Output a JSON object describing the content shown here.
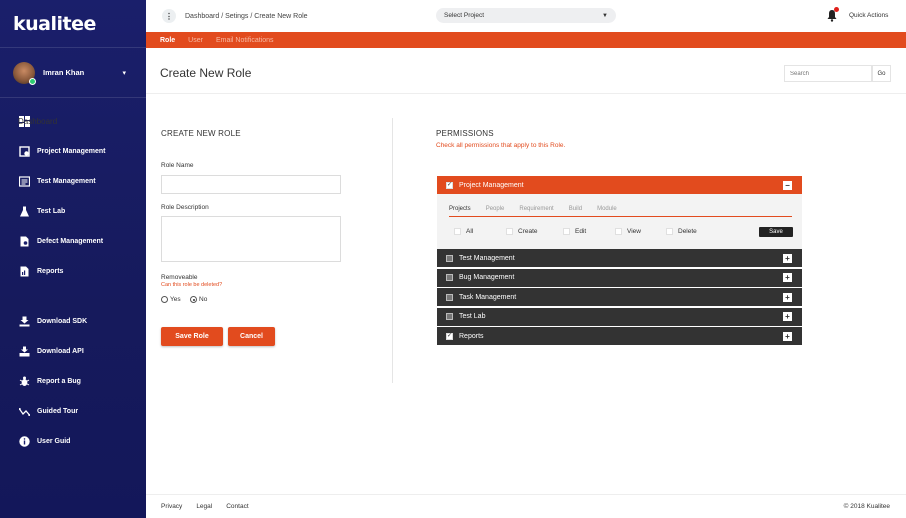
{
  "brand": {
    "logo": "kualitee"
  },
  "user": {
    "name": "Imran Khan"
  },
  "sidebar": {
    "items": [
      {
        "label": "Dashboard",
        "icon": "dashboard-icon"
      },
      {
        "label": "Project Management",
        "icon": "project-management-icon"
      },
      {
        "label": "Test Management",
        "icon": "test-management-icon"
      },
      {
        "label": "Test Lab",
        "icon": "flask-icon"
      },
      {
        "label": "Defect Management",
        "icon": "defect-icon"
      },
      {
        "label": "Reports",
        "icon": "reports-icon"
      }
    ],
    "bottom_items": [
      {
        "label": "Download SDK",
        "icon": "download-sdk-icon"
      },
      {
        "label": "Download API",
        "icon": "download-api-icon"
      },
      {
        "label": "Report a Bug",
        "icon": "bug-icon"
      },
      {
        "label": "Guided Tour",
        "icon": "tour-icon"
      },
      {
        "label": "User Guid",
        "icon": "info-icon"
      }
    ]
  },
  "topbar": {
    "breadcrumb": "Dashboard / Setings / Create New Role",
    "project_select": "Select Project",
    "quick_actions": "Quick Actions"
  },
  "subnav": {
    "tabs": [
      "Role",
      "User",
      "Email Notifications"
    ],
    "active": "Role"
  },
  "page": {
    "title": "Create New Role",
    "search_placeholder": "Search",
    "go_label": "Go"
  },
  "form": {
    "heading": "CREATE NEW ROLE",
    "role_name_label": "Role Name",
    "role_name_value": "",
    "role_desc_label": "Role Description",
    "role_desc_value": "",
    "removeable_label": "Removeable",
    "removeable_hint": "Can this role be deleted?",
    "yes_label": "Yes",
    "no_label": "No",
    "selected": "No",
    "save_label": "Save Role",
    "cancel_label": "Cancel"
  },
  "permissions": {
    "heading": "PERMISSIONS",
    "subheading": "Check all permissions that apply to this Role.",
    "expanded": {
      "title": "Project Management",
      "checked": true,
      "tabs": [
        "Projects",
        "People",
        "Requirement",
        "Build",
        "Module"
      ],
      "active_tab": "Projects",
      "options": [
        "All",
        "Create",
        "Edit",
        "View",
        "Delete"
      ],
      "save_label": "Save"
    },
    "collapsed": [
      {
        "title": "Test Management",
        "checked": false
      },
      {
        "title": "Bug Management",
        "checked": false
      },
      {
        "title": "Task Management",
        "checked": false
      },
      {
        "title": "Test Lab",
        "checked": false
      },
      {
        "title": "Reports",
        "checked": true
      }
    ]
  },
  "footer": {
    "links": [
      "Privacy",
      "Legal",
      "Contact"
    ],
    "copyright": "© 2018 Kualitee"
  },
  "colors": {
    "accent": "#e24b1e",
    "sidebar": "#1a1f6b",
    "dark_panel": "#333333"
  }
}
